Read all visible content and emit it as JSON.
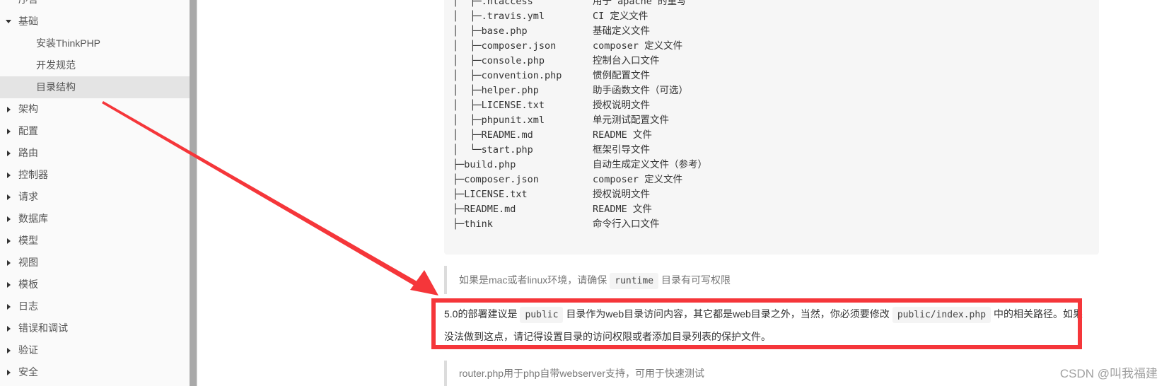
{
  "sidebar": {
    "items": [
      {
        "label": "序言",
        "level": "top",
        "caret": "none"
      },
      {
        "label": "基础",
        "level": "top",
        "caret": "expanded"
      },
      {
        "label": "安装ThinkPHP",
        "level": "child",
        "caret": "none"
      },
      {
        "label": "开发规范",
        "level": "child",
        "caret": "none"
      },
      {
        "label": "目录结构",
        "level": "child",
        "caret": "none",
        "active": true
      },
      {
        "label": "架构",
        "level": "top",
        "caret": "collapsed"
      },
      {
        "label": "配置",
        "level": "top",
        "caret": "collapsed"
      },
      {
        "label": "路由",
        "level": "top",
        "caret": "collapsed"
      },
      {
        "label": "控制器",
        "level": "top",
        "caret": "collapsed"
      },
      {
        "label": "请求",
        "level": "top",
        "caret": "collapsed"
      },
      {
        "label": "数据库",
        "level": "top",
        "caret": "collapsed"
      },
      {
        "label": "模型",
        "level": "top",
        "caret": "collapsed"
      },
      {
        "label": "视图",
        "level": "top",
        "caret": "collapsed"
      },
      {
        "label": "模板",
        "level": "top",
        "caret": "collapsed"
      },
      {
        "label": "日志",
        "level": "top",
        "caret": "collapsed"
      },
      {
        "label": "错误和调试",
        "level": "top",
        "caret": "collapsed"
      },
      {
        "label": "验证",
        "level": "top",
        "caret": "collapsed"
      },
      {
        "label": "安全",
        "level": "top",
        "caret": "collapsed"
      }
    ]
  },
  "tree": {
    "rows": [
      {
        "name": "│  ├─.htaccess",
        "desc": "用于 apache 的重写"
      },
      {
        "name": "│  ├─.travis.yml",
        "desc": "CI 定义文件"
      },
      {
        "name": "│  ├─base.php",
        "desc": "基础定义文件"
      },
      {
        "name": "│  ├─composer.json",
        "desc": "composer 定义文件"
      },
      {
        "name": "│  ├─console.php",
        "desc": "控制台入口文件"
      },
      {
        "name": "│  ├─convention.php",
        "desc": "惯例配置文件"
      },
      {
        "name": "│  ├─helper.php",
        "desc": "助手函数文件（可选）"
      },
      {
        "name": "│  ├─LICENSE.txt",
        "desc": "授权说明文件"
      },
      {
        "name": "│  ├─phpunit.xml",
        "desc": "单元测试配置文件"
      },
      {
        "name": "│  ├─README.md",
        "desc": "README 文件"
      },
      {
        "name": "│  └─start.php",
        "desc": "框架引导文件"
      },
      {
        "name": "├─build.php",
        "desc": "自动生成定义文件（参考）"
      },
      {
        "name": "├─composer.json",
        "desc": "composer 定义文件"
      },
      {
        "name": "├─LICENSE.txt",
        "desc": "授权说明文件"
      },
      {
        "name": "├─README.md",
        "desc": "README 文件"
      },
      {
        "name": "├─think",
        "desc": "命令行入口文件"
      }
    ]
  },
  "notes": {
    "mac_linux": {
      "before": "如果是mac或者linux环境，请确保",
      "code": "runtime",
      "after": "目录有可写权限"
    },
    "deploy": {
      "part1": "5.0的部署建议是",
      "code1": "public",
      "part2": "目录作为web目录访问内容，其它都是web目录之外，当然，你必须要修改",
      "code2": "public/index.php",
      "part3": "中的相关路径。如果没法做到这点，请记得设置目录的访问权限或者添加目录列表的保护文件。"
    },
    "router": {
      "text": "router.php用于php自带webserver支持，可用于快速测试"
    }
  },
  "annotation": {
    "color": "#f5363a"
  },
  "watermark": "CSDN @叫我福建"
}
